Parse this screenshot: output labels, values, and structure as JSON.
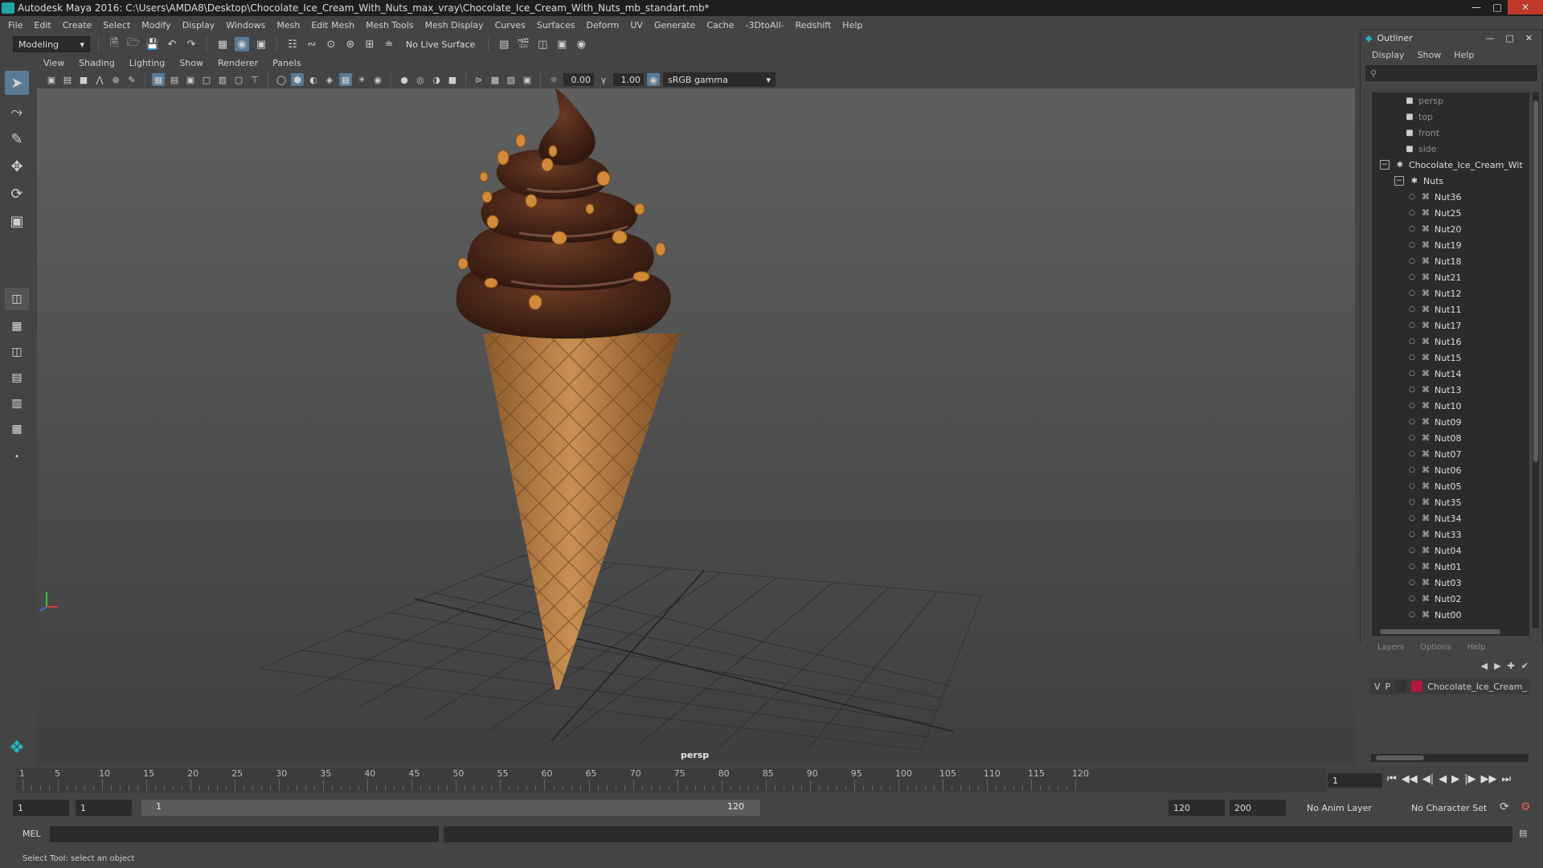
{
  "window": {
    "title": "Autodesk Maya 2016: C:\\Users\\AMDA8\\Desktop\\Chocolate_Ice_Cream_With_Nuts_max_vray\\Chocolate_Ice_Cream_With_Nuts_mb_standart.mb*"
  },
  "menus": [
    "File",
    "Edit",
    "Create",
    "Select",
    "Modify",
    "Display",
    "Windows",
    "Mesh",
    "Edit Mesh",
    "Mesh Tools",
    "Mesh Display",
    "Curves",
    "Surfaces",
    "Deform",
    "UV",
    "Generate",
    "Cache",
    "-3DtoAll-",
    "Redshift",
    "Help"
  ],
  "shelf": {
    "mode": "Modeling",
    "live_surface": "No Live Surface"
  },
  "viewport": {
    "menus": [
      "View",
      "Shading",
      "Lighting",
      "Show",
      "Renderer",
      "Panels"
    ],
    "exposure": "0.00",
    "gamma_value": "1.00",
    "color_space": "sRGB gamma",
    "camera_label": "persp"
  },
  "outliner": {
    "title": "Outliner",
    "menus": [
      "Display",
      "Show",
      "Help"
    ],
    "cameras": [
      "persp",
      "top",
      "front",
      "side"
    ],
    "root": "Chocolate_Ice_Cream_Wit",
    "group": "Nuts",
    "nuts": [
      "Nut36",
      "Nut25",
      "Nut20",
      "Nut19",
      "Nut18",
      "Nut21",
      "Nut12",
      "Nut11",
      "Nut17",
      "Nut16",
      "Nut15",
      "Nut14",
      "Nut13",
      "Nut10",
      "Nut09",
      "Nut08",
      "Nut07",
      "Nut06",
      "Nut05",
      "Nut35",
      "Nut34",
      "Nut33",
      "Nut04",
      "Nut01",
      "Nut03",
      "Nut02",
      "Nut00"
    ]
  },
  "layers": {
    "menus": [
      "Layers",
      "Options",
      "Help"
    ],
    "row": {
      "v": "V",
      "p": "P",
      "name": "Chocolate_Ice_Cream_",
      "color": "#b0183c"
    }
  },
  "timeline": {
    "ticks": [
      1,
      5,
      10,
      15,
      20,
      25,
      30,
      35,
      40,
      45,
      50,
      55,
      60,
      65,
      70,
      75,
      80,
      85,
      90,
      95,
      100,
      105,
      110,
      115,
      120
    ],
    "current_frame": "1",
    "start": 1,
    "end": 120
  },
  "range": {
    "start_frame": "1",
    "playback_start": "1",
    "slider_start": "1",
    "slider_end": "120",
    "playback_end": "120",
    "end_frame": "200",
    "anim_layer": "No Anim Layer",
    "character_set": "No Character Set"
  },
  "command": {
    "label": "MEL"
  },
  "help_line": "Select Tool: select an object"
}
